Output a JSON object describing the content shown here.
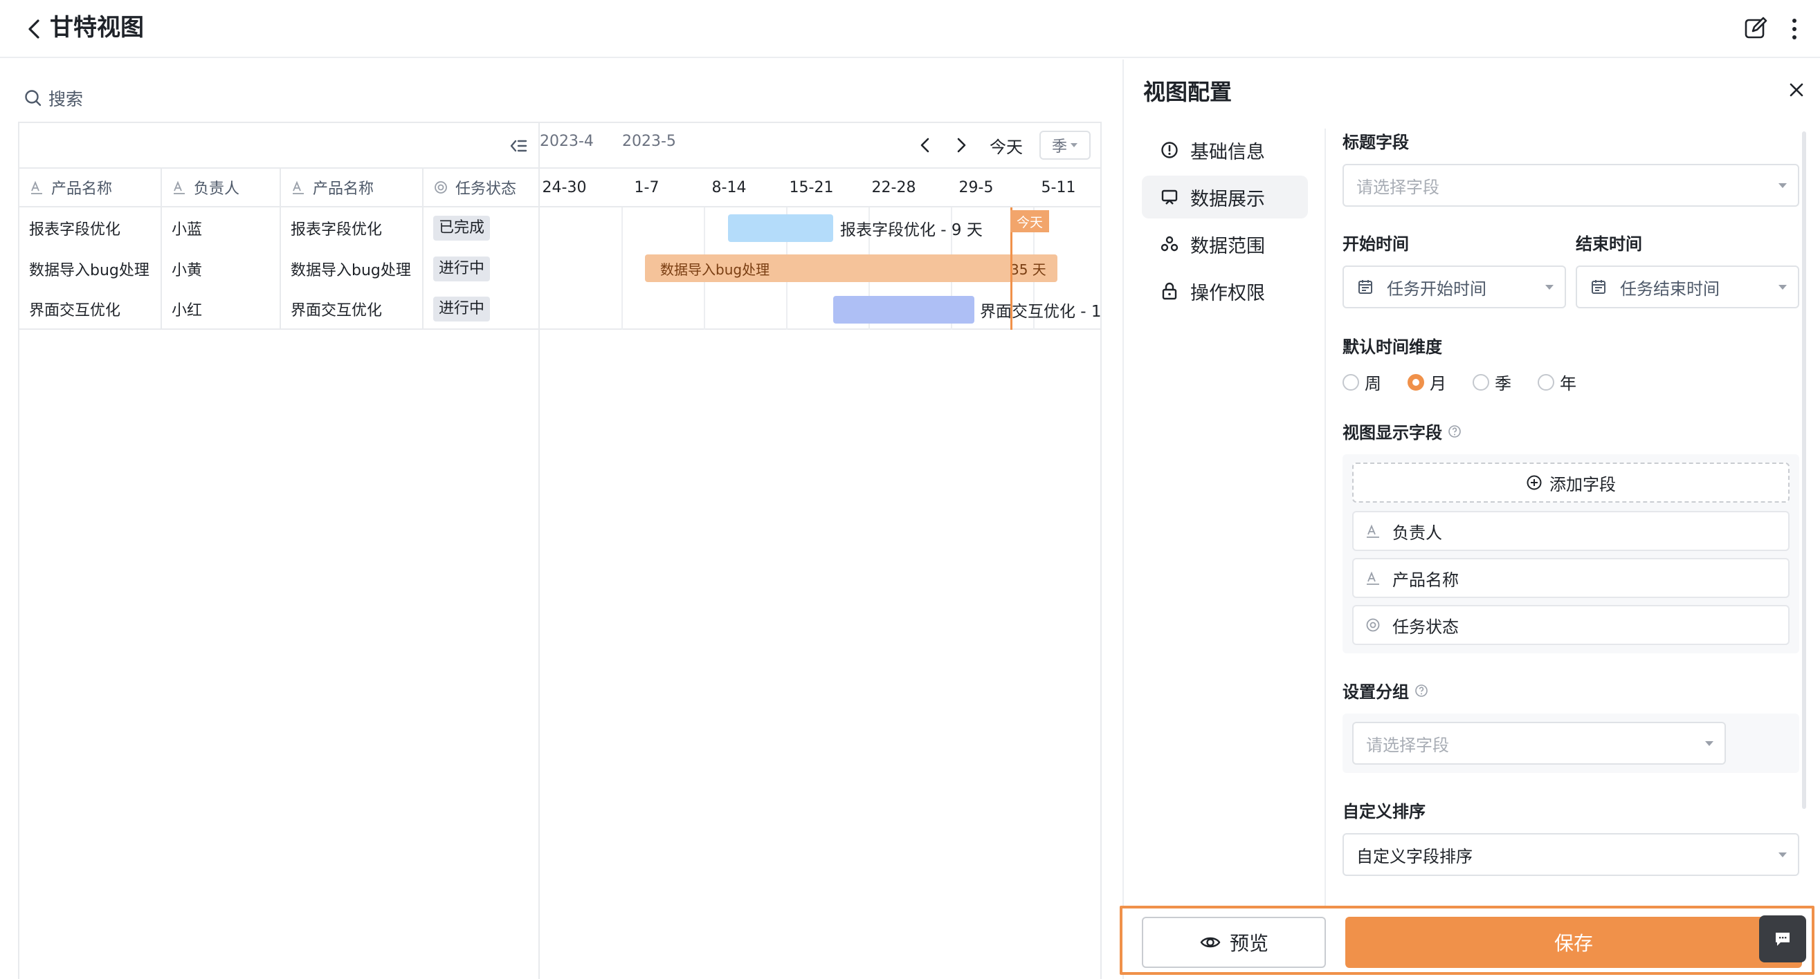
{
  "header": {
    "title": "甘特视图"
  },
  "search": {
    "label": "搜索"
  },
  "table": {
    "columns": [
      "产品名称",
      "负责人",
      "产品名称",
      "任务状态"
    ],
    "rows": [
      {
        "name": "报表字段优化",
        "owner": "小蓝",
        "product": "报表字段优化",
        "status": "已完成"
      },
      {
        "name": "数据导入bug处理",
        "owner": "小黄",
        "product": "数据导入bug处理",
        "status": "进行中"
      },
      {
        "name": "界面交互优化",
        "owner": "小红",
        "product": "界面交互优化",
        "status": "进行中"
      }
    ]
  },
  "gantt": {
    "months": [
      "2023-4",
      "2023-5"
    ],
    "today_label": "今天",
    "scale_value": "季",
    "weeks": [
      "24-30",
      "1-7",
      "8-14",
      "15-21",
      "22-28",
      "29-5",
      "5-11"
    ],
    "today_tag": "今天",
    "bars": [
      {
        "label": "报表字段优化 - 9 天",
        "color": "#b4dcfa"
      },
      {
        "label": "数据导入bug处理",
        "duration": "35 天",
        "color": "#f5c39a"
      },
      {
        "label": "界面交互优化 - 1",
        "color": "#aebff5"
      }
    ]
  },
  "panel": {
    "title": "视图配置",
    "nav": [
      "基础信息",
      "数据展示",
      "数据范围",
      "操作权限"
    ],
    "active_nav": "数据展示",
    "title_field": {
      "label": "标题字段",
      "placeholder": "请选择字段"
    },
    "start_time": {
      "label": "开始时间",
      "value": "任务开始时间"
    },
    "end_time": {
      "label": "结束时间",
      "value": "任务结束时间"
    },
    "time_dimension": {
      "label": "默认时间维度",
      "options": [
        "周",
        "月",
        "季",
        "年"
      ],
      "selected": "月"
    },
    "display_fields": {
      "label": "视图显示字段",
      "add_label": "添加字段",
      "items": [
        "负责人",
        "产品名称",
        "任务状态"
      ]
    },
    "group": {
      "label": "设置分组",
      "placeholder": "请选择字段"
    },
    "sort": {
      "label": "自定义排序",
      "value": "自定义字段排序"
    }
  },
  "footer": {
    "preview_label": "预览",
    "save_label": "保存"
  },
  "colors": {
    "accent": "#f0914a",
    "today_tag": "#f2a56b"
  }
}
